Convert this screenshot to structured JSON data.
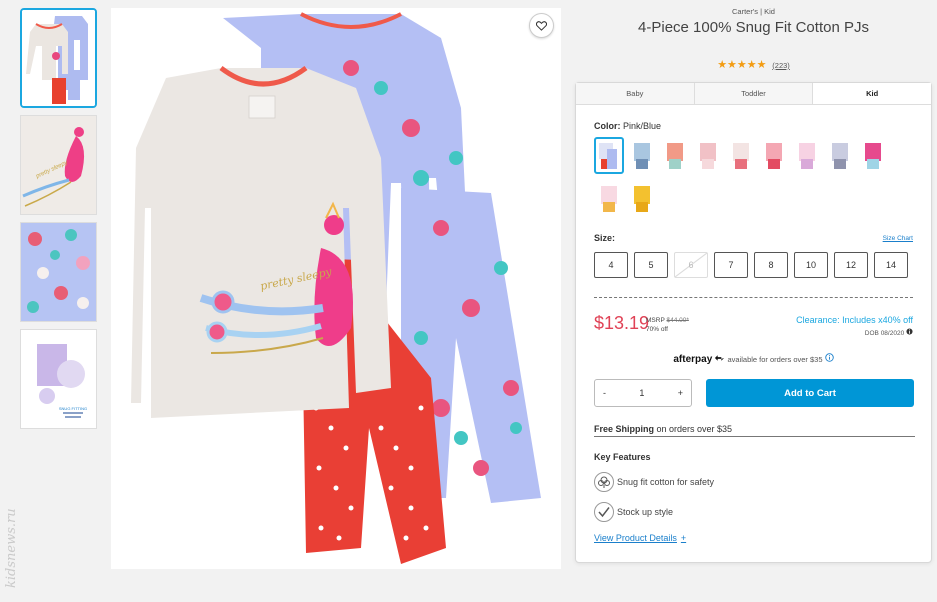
{
  "product": {
    "brand_line": "Carter's | Kid",
    "title": "4-Piece 100% Snug Fit Cotton PJs",
    "stars": "★★★★★",
    "review_count": "(223)"
  },
  "tabs": [
    "Baby",
    "Toddler",
    "Kid"
  ],
  "color": {
    "label": "Color:",
    "value": "Pink/Blue",
    "swatch_colors": [
      "#dfe3f5",
      "#a9c6e0",
      "#f19a87",
      "#f1c1c6",
      "#f3e4e3",
      "#f4a7b3",
      "#f7d2e3",
      "#c9cce0",
      "#e64a8d",
      "#f8d9e2",
      "#f3c12f"
    ]
  },
  "size": {
    "label": "Size:",
    "chart_link": "Size Chart",
    "options": [
      "4",
      "5",
      "6",
      "7",
      "8",
      "10",
      "12",
      "14"
    ],
    "unavailable": [
      "6"
    ]
  },
  "pricing": {
    "price": "$13.19",
    "msrp_label": "MSRP",
    "msrp_value": "$44.00*",
    "percent_off": "70% off",
    "clearance": "Clearance: Includes x40% off",
    "dob": "DOB 08/2020"
  },
  "afterpay": {
    "logo": "afterpay",
    "text": "available for orders over $35"
  },
  "cart": {
    "minus": "-",
    "quantity": "1",
    "plus": "+",
    "add_label": "Add to Cart"
  },
  "shipping": {
    "bold": "Free Shipping",
    "rest": " on orders over $35"
  },
  "features": {
    "heading": "Key Features",
    "items": [
      "Snug fit cotton for safety",
      "Stock up style"
    ],
    "details_link": "View Product Details",
    "details_plus": "+"
  },
  "image_text": {
    "shirt_script": "pretty sleepy",
    "thumb_script": "pretty sleepy",
    "thumb4_caption": "SNUG FITTING"
  },
  "watermark": "kidsnews.ru",
  "colors": {
    "accent": "#0096d6",
    "sale": "#e04256",
    "link": "#1a7fcb",
    "star": "#f39c12"
  }
}
